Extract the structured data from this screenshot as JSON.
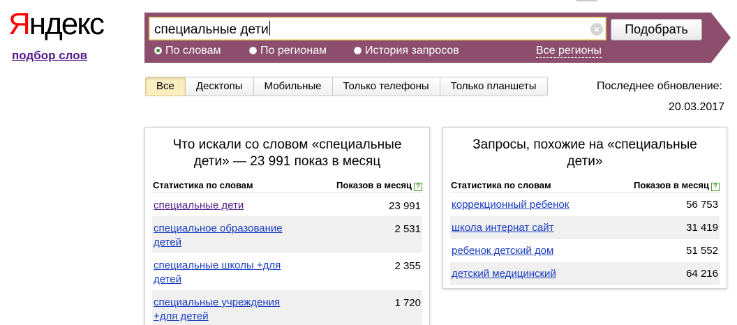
{
  "logo": {
    "first_letter": "Я",
    "rest": "ндекс"
  },
  "service_link": "подбор слов",
  "search": {
    "query": "специальные дети",
    "submit_label": "Подобрать",
    "clear_glyph": "×",
    "modes": [
      {
        "label": "По словам",
        "selected": true
      },
      {
        "label": "По регионам",
        "selected": false
      },
      {
        "label": "История запросов",
        "selected": false
      }
    ],
    "regions_link": "Все регионы"
  },
  "colors": {
    "bar": "#8c4e6c",
    "link": "#1a3dc1",
    "visited": "#551a8b",
    "logo_red": "#ff0000"
  },
  "device_tabs": [
    {
      "label": "Все",
      "active": true
    },
    {
      "label": "Десктопы",
      "active": false
    },
    {
      "label": "Мобильные",
      "active": false
    },
    {
      "label": "Только телефоны",
      "active": false
    },
    {
      "label": "Только планшеты",
      "active": false
    }
  ],
  "updated": {
    "label": "Последнее обновление:",
    "date": "20.03.2017"
  },
  "left_panel": {
    "title_line1": "Что искали со словом «специальные",
    "title_line2": "дети» — 23 991 показ в месяц",
    "col_words": "Статистика по словам",
    "col_shows": "Показов в месяц",
    "help_glyph": "?",
    "rows": [
      {
        "line1": "специальные дети",
        "line2": "",
        "shows": "23 991",
        "visited": true
      },
      {
        "line1": "специальное образование",
        "line2": "детей",
        "shows": "2 531",
        "visited": false
      },
      {
        "line1": "специальные школы +для",
        "line2": "детей",
        "shows": "2 355",
        "visited": false
      },
      {
        "line1": "специальные учреждения",
        "line2": "+для детей",
        "shows": "1 720",
        "visited": false
      }
    ]
  },
  "right_panel": {
    "title_line1": "Запросы, похожие на «специальные",
    "title_line2": "дети»",
    "col_words": "Статистика по словам",
    "col_shows": "Показов в месяц",
    "help_glyph": "?",
    "rows": [
      {
        "line1": "коррекционный ребенок",
        "shows": "56 753"
      },
      {
        "line1": "школа интернат сайт",
        "shows": "31 419"
      },
      {
        "line1": "ребенок детский дом",
        "shows": "51 552"
      },
      {
        "line1": "детский медицинский",
        "shows": "64 216"
      }
    ]
  }
}
